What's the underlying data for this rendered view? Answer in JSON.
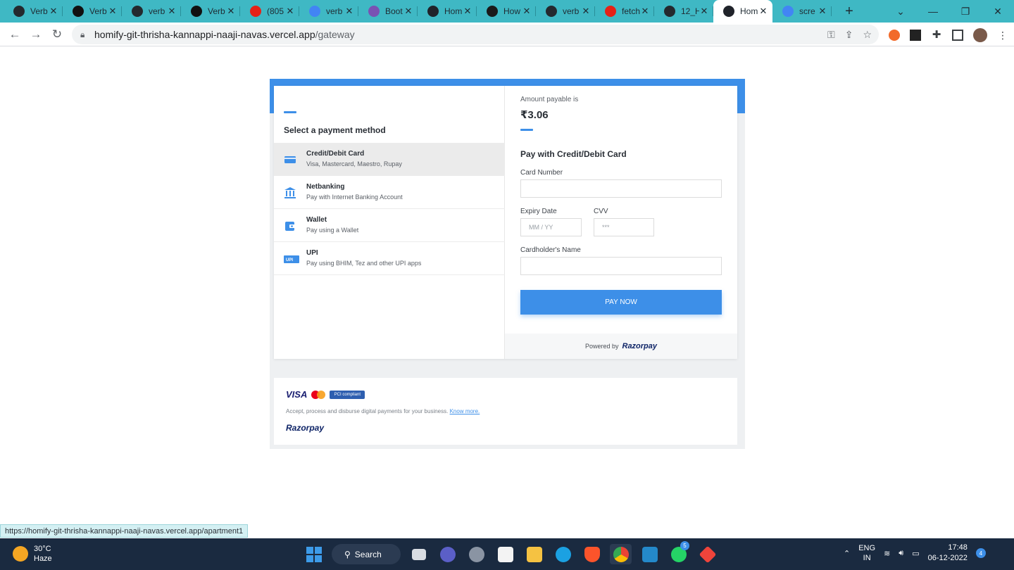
{
  "browser": {
    "tabs": [
      {
        "title": "Verb",
        "icon": "github-icon",
        "color": "#24292e"
      },
      {
        "title": "Verb",
        "icon": "verbalize-icon",
        "color": "#111111"
      },
      {
        "title": "verb",
        "icon": "github-icon",
        "color": "#24292e"
      },
      {
        "title": "Verb",
        "icon": "verbalize-icon",
        "color": "#111111"
      },
      {
        "title": "(805",
        "icon": "youtube-icon",
        "color": "#e62117"
      },
      {
        "title": "verb",
        "icon": "google-icon",
        "color": "#4285f4"
      },
      {
        "title": "Boot",
        "icon": "bootstrap-icon",
        "color": "#7952b3"
      },
      {
        "title": "Hom",
        "icon": "react-icon",
        "color": "#20232a"
      },
      {
        "title": "How",
        "icon": "angular-icon",
        "color": "#1a1a1a"
      },
      {
        "title": "verb",
        "icon": "github-icon",
        "color": "#24292e"
      },
      {
        "title": "fetch",
        "icon": "youtube-icon",
        "color": "#e62117"
      },
      {
        "title": "12_H",
        "icon": "globe-icon",
        "color": "#24292e"
      },
      {
        "title": "Hom",
        "icon": "react-icon",
        "color": "#20232a",
        "active": true
      },
      {
        "title": "scre",
        "icon": "google-icon",
        "color": "#4285f4"
      }
    ],
    "url_host": "homify-git-thrisha-kannappi-naaji-navas.vercel.app",
    "url_path": "/gateway",
    "status_url": "https://homify-git-thrisha-kannappi-naaji-navas.vercel.app/apartment1"
  },
  "checkout": {
    "left_title": "Select a payment method",
    "methods": [
      {
        "title": "Credit/Debit Card",
        "subtitle": "Visa, Mastercard, Maestro, Rupay",
        "icon": "card-icon",
        "selected": true
      },
      {
        "title": "Netbanking",
        "subtitle": "Pay with Internet Banking Account",
        "icon": "bank-icon"
      },
      {
        "title": "Wallet",
        "subtitle": "Pay using a Wallet",
        "icon": "wallet-icon"
      },
      {
        "title": "UPI",
        "subtitle": "Pay using BHIM, Tez and other UPI apps",
        "icon": "upi-icon"
      }
    ],
    "amount_label": "Amount payable is",
    "amount": "₹3.06",
    "pay_title": "Pay with Credit/Debit Card",
    "fields": {
      "card_number_label": "Card Number",
      "expiry_label": "Expiry Date",
      "expiry_placeholder": "MM / YY",
      "cvv_label": "CVV",
      "cvv_placeholder": "***",
      "name_label": "Cardholder's Name"
    },
    "pay_button": "PAY NOW",
    "powered_by": "Powered by",
    "brand": "Razorpay",
    "footer_desc": "Accept, process and disburse digital payments for your business.",
    "footer_link": "Know more.",
    "visa": "VISA",
    "pci": "PCI compliant",
    "accent": "#3d8fe8"
  },
  "taskbar": {
    "temp": "30°C",
    "weather": "Haze",
    "search": "Search",
    "lang1": "ENG",
    "lang2": "IN",
    "time": "17:48",
    "date": "06-12-2022",
    "whatsapp_badge": "5",
    "notif_count": "4"
  }
}
